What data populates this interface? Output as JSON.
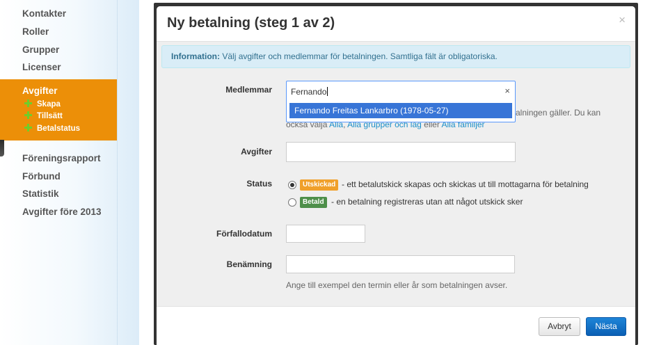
{
  "sidebar": {
    "items_top": [
      {
        "label": "Kontakter"
      },
      {
        "label": "Roller"
      },
      {
        "label": "Grupper"
      },
      {
        "label": "Licenser"
      }
    ],
    "active": {
      "label": "Avgifter",
      "sub_items": [
        {
          "label": "Skapa"
        },
        {
          "label": "Tillsätt"
        },
        {
          "label": "Betalstatus"
        }
      ]
    },
    "items_bottom": [
      {
        "label": "Föreningsrapport"
      },
      {
        "label": "Förbund"
      },
      {
        "label": "Statistik"
      },
      {
        "label": "Avgifter före 2013"
      }
    ]
  },
  "modal": {
    "title": "Ny betalning (steg 1 av 2)",
    "close_glyph": "×",
    "info": {
      "prefix": "Information:",
      "text": "Välj avgifter och medlemmar för betalningen. Samtliga fält är obligatoriska."
    },
    "members": {
      "label": "Medlemmar",
      "value": "Fernando",
      "clear_glyph": "×",
      "option": "Fernando Freitas Lankarbro (1978-05-27)",
      "help_right": "etalningen gäller. Du kan",
      "help_line2_prefix": "också välja",
      "link_all": "Alla",
      "link_groups": "Alla grupper och lag",
      "help_or": "eller",
      "link_families": "Alla familjer"
    },
    "fees": {
      "label": "Avgifter",
      "value": ""
    },
    "status": {
      "label": "Status",
      "options": [
        {
          "badge": "Utskickad",
          "badge_color": "#f0a02a",
          "text": "- ett betalutskick skapas och skickas ut till mottagarna för betalning",
          "selected": true
        },
        {
          "badge": "Betald",
          "badge_color": "#4e8f4a",
          "text": "- en betalning registreras utan att något utskick sker",
          "selected": false
        }
      ]
    },
    "due_date": {
      "label": "Förfallodatum",
      "value": ""
    },
    "name": {
      "label": "Benämning",
      "value": "",
      "help": "Ange till exempel den termin eller år som betalningen avser."
    },
    "buttons": {
      "cancel": "Avbryt",
      "next": "Nästa"
    }
  }
}
